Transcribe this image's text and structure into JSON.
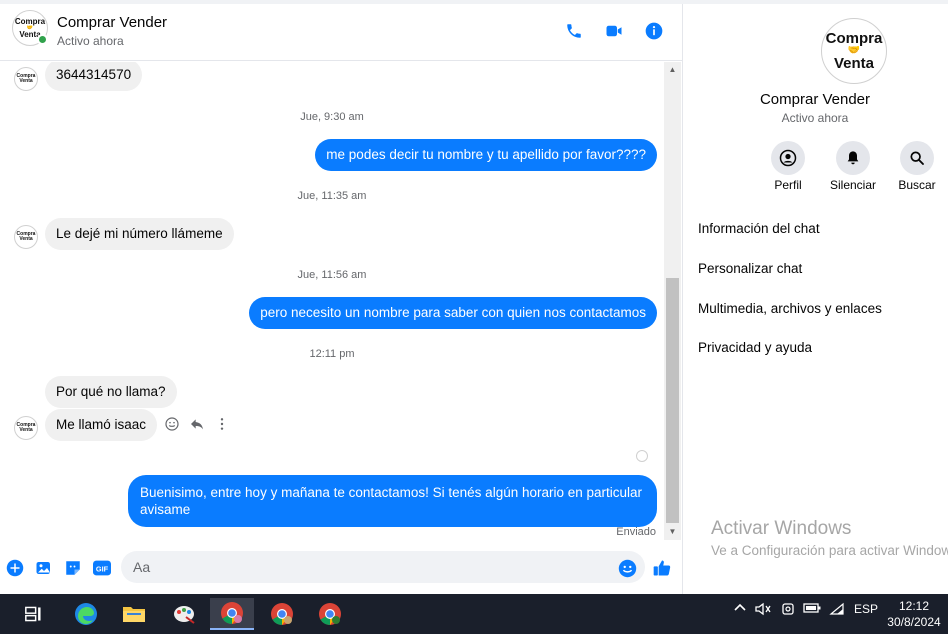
{
  "header": {
    "contact_name": "Comprar Vender",
    "status": "Activo ahora",
    "avatar_text_top": "Compra",
    "avatar_text_bottom": "Venta"
  },
  "messages": {
    "m1": "3644314570",
    "ts1": "Jue, 9:30 am",
    "m2": "me podes decir tu nombre y tu apellido por favor????",
    "ts2": "Jue, 11:35 am",
    "m3": "Le dejé mi número llámeme",
    "ts3": "Jue, 11:56 am",
    "m4": "pero necesito un nombre para saber con quien nos contactamos",
    "ts4": "12:11 pm",
    "m5": "Por qué no llama?",
    "m6": "Me llamó isaac",
    "m7": "Buenisimo, entre hoy y mañana te contactamos! Si tenés algún horario en particular avisame",
    "sent_status": "Enviado"
  },
  "composer": {
    "placeholder": "Aa"
  },
  "right_panel": {
    "name": "Comprar Vender",
    "status": "Activo ahora",
    "avatar_text_top": "Compra",
    "avatar_text_bottom": "Venta",
    "actions": [
      "Perfil",
      "Silenciar",
      "Buscar"
    ],
    "sections": [
      "Información del chat",
      "Personalizar chat",
      "Multimedia, archivos y enlaces",
      "Privacidad y ayuda"
    ]
  },
  "windows_watermark": {
    "line1": "Activar Windows",
    "line2": "Ve a Configuración para activar Windows."
  },
  "taskbar": {
    "language": "ESP",
    "time": "12:12",
    "date": "30/8/2024"
  },
  "colors": {
    "accent": "#0a7cff",
    "online": "#31a24c",
    "incoming_bubble": "#f0f0f0"
  }
}
